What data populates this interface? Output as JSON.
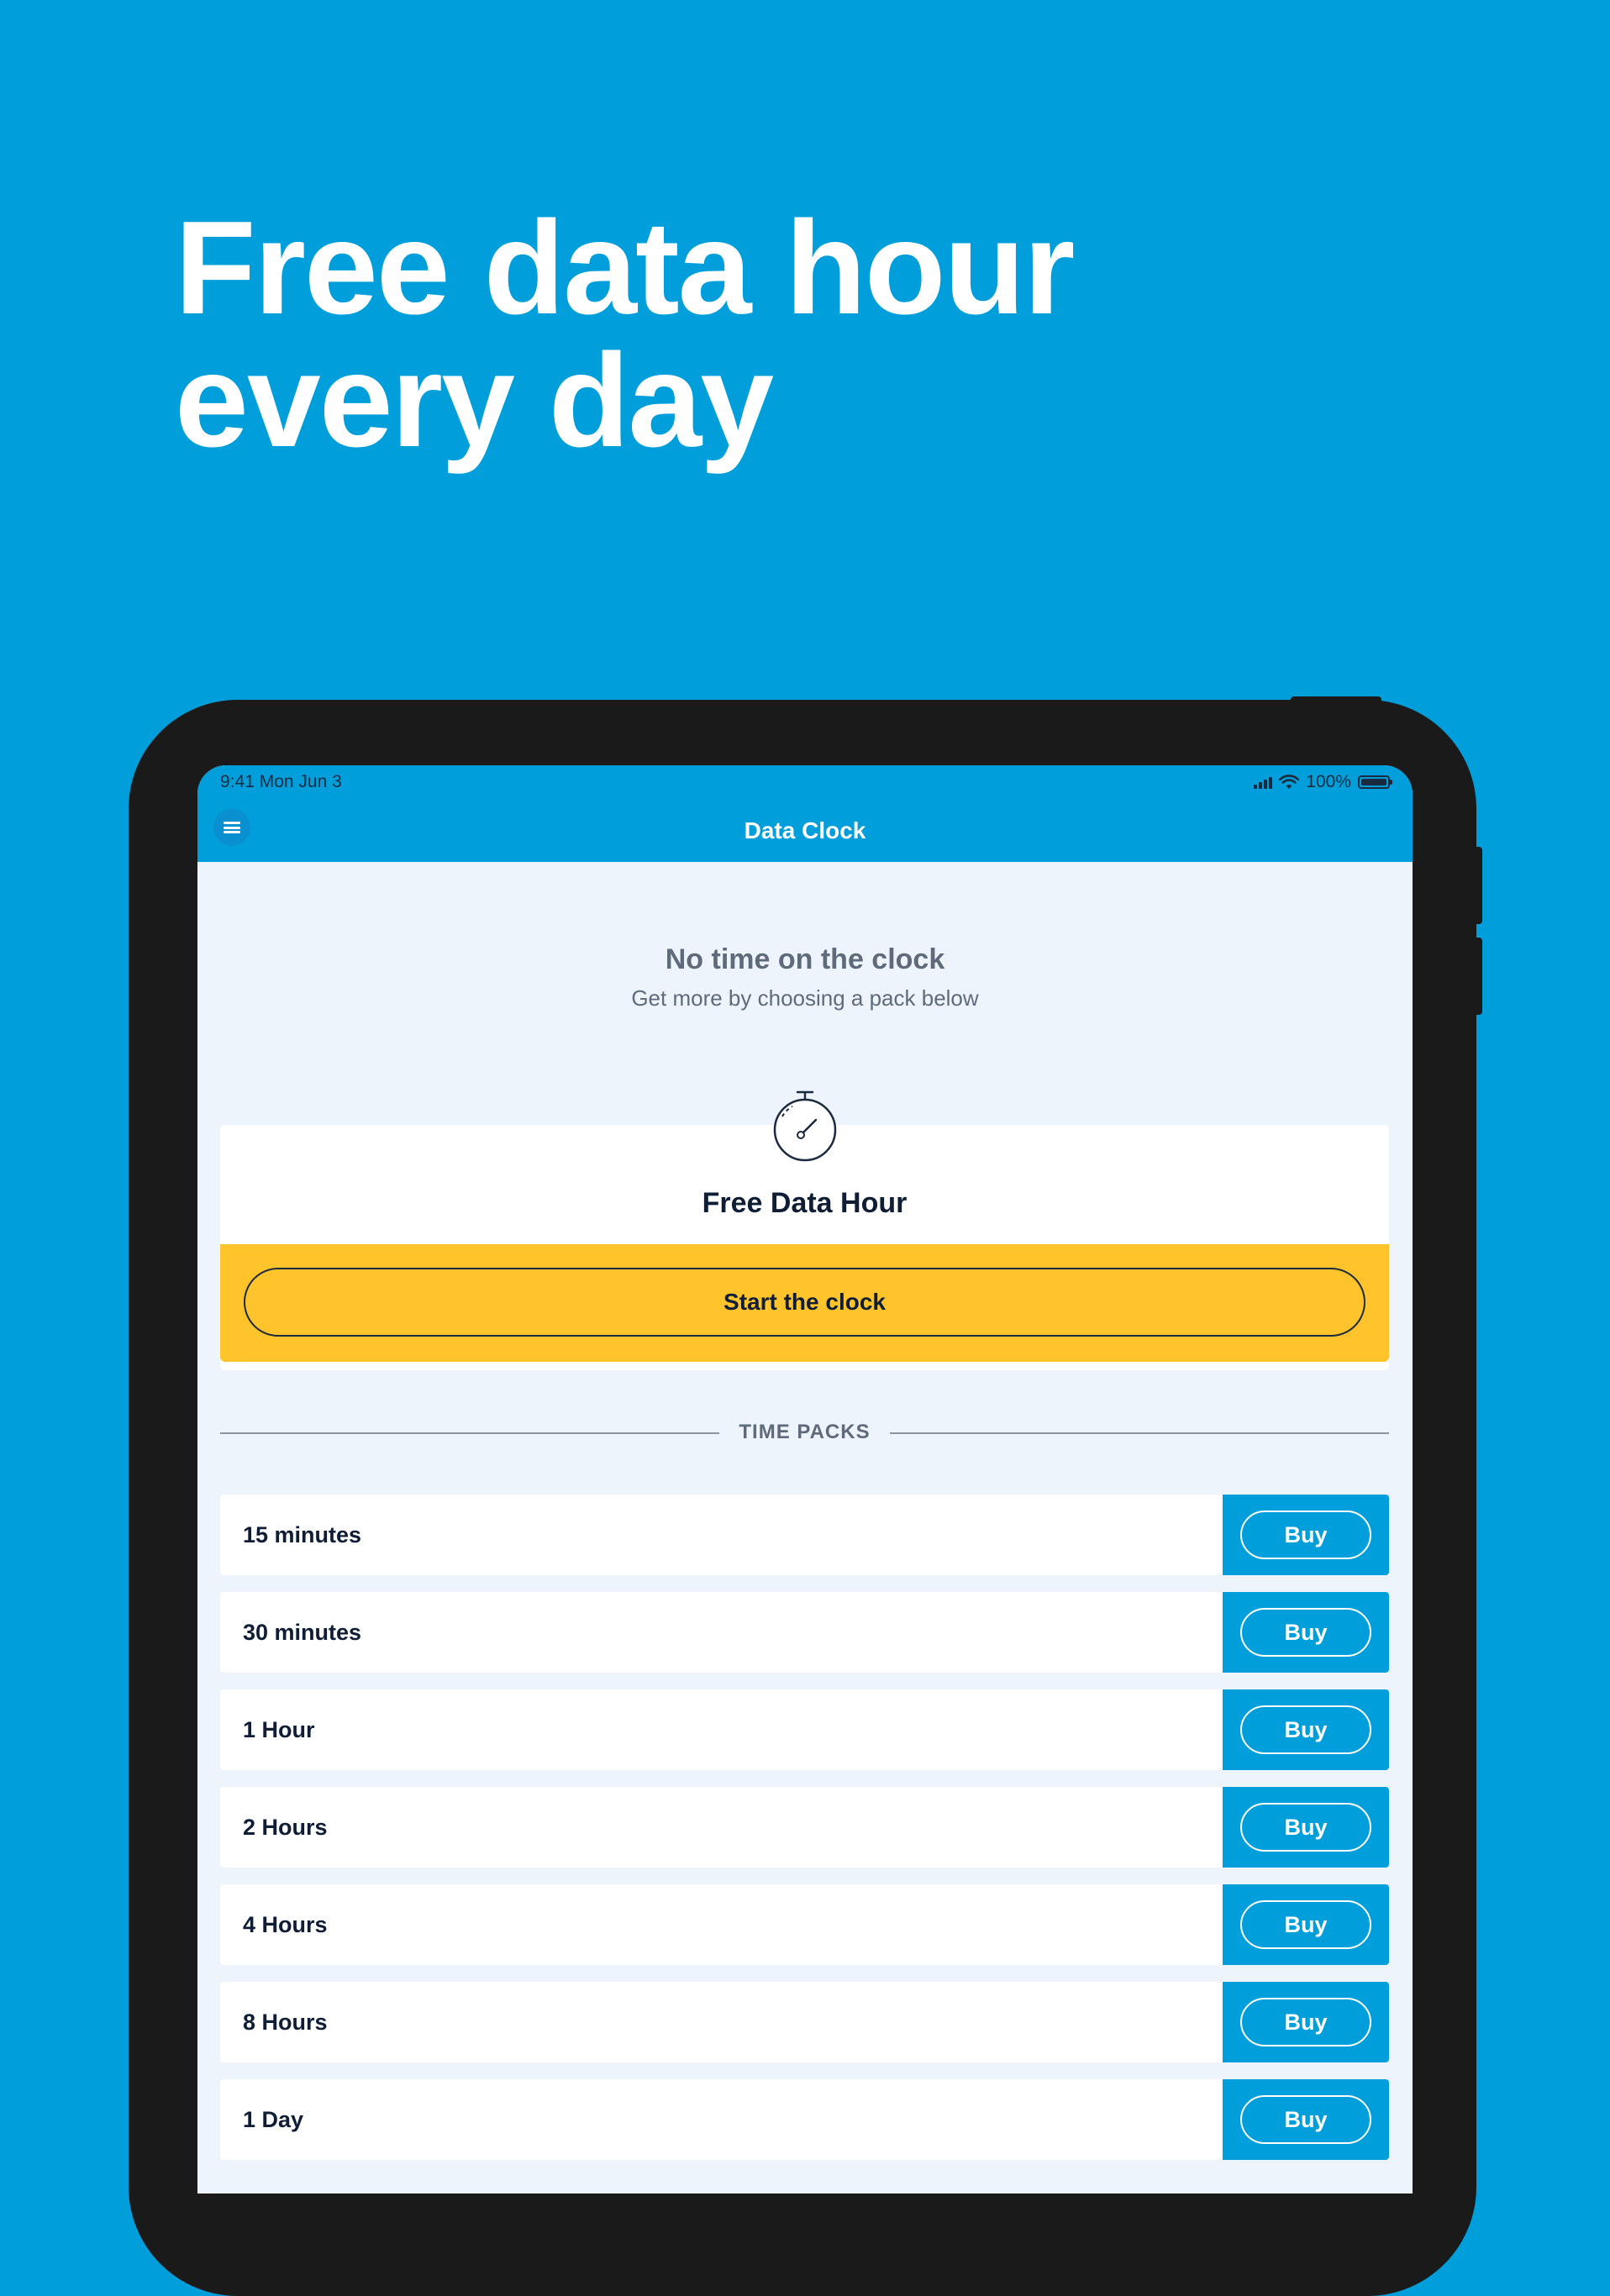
{
  "headline": {
    "line1": "Free data hour",
    "line2": "every day"
  },
  "status_bar": {
    "time": "9:41  Mon Jun 3",
    "battery": "100%"
  },
  "nav": {
    "title": "Data Clock"
  },
  "empty_state": {
    "title": "No time on the clock",
    "subtitle": "Get more by choosing a pack below"
  },
  "free_card": {
    "title": "Free Data Hour",
    "button": "Start the clock"
  },
  "section": {
    "label": "TIME PACKS"
  },
  "packs": [
    {
      "label": "15 minutes",
      "button": "Buy"
    },
    {
      "label": "30 minutes",
      "button": "Buy"
    },
    {
      "label": "1 Hour",
      "button": "Buy"
    },
    {
      "label": "2 Hours",
      "button": "Buy"
    },
    {
      "label": "4 Hours",
      "button": "Buy"
    },
    {
      "label": "8 Hours",
      "button": "Buy"
    },
    {
      "label": "1 Day",
      "button": "Buy"
    }
  ],
  "colors": {
    "brand_blue": "#009fdb",
    "accent_yellow": "#ffc42b",
    "text_dark": "#0f1d35"
  },
  "icons": [
    "menu-icon",
    "signal-icon",
    "wifi-icon",
    "battery-icon",
    "stopwatch-icon"
  ]
}
